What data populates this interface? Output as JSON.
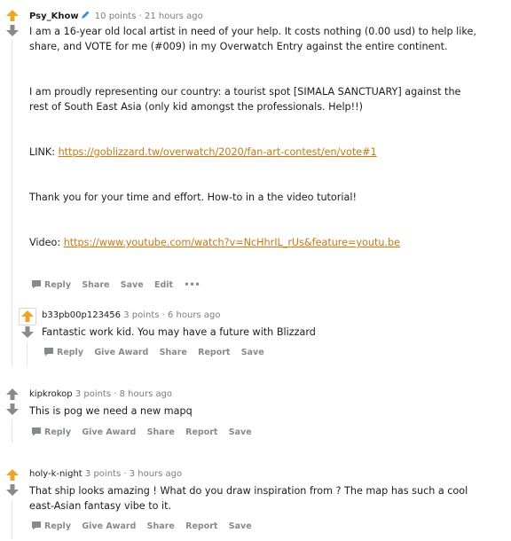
{
  "colors": {
    "upvote": "#f0a420",
    "downvote": "#8a8a8a",
    "link": "#c9780e"
  },
  "comments": [
    {
      "author": "Psy_Khow",
      "author_icon": "pen-icon",
      "points": "10 points",
      "time": "21 hours ago",
      "upvoted": true,
      "paragraphs": [
        "I am a 16-year old local artist in need of your help. It costs nothing (0.00 usd) to help like, share, and VOTE for me (#009) in my Overwatch Entry against the entire continent.",
        "I am proudly representing our country: a tourist spot [SIMALA SANCTUARY] against the rest of South East Asia (only kid amongst the professionals. Help!!)"
      ],
      "link_label": "LINK:",
      "link_url": "https://goblizzard.tw/overwatch/2020/fan-art-contest/en/vote#1",
      "thanks": "Thank you for your time and effort. How-to in a the video tutorial!",
      "video_label": "Video:",
      "video_url": "https://www.youtube.com/watch?v=NcHhrIL_rUs&feature=youtu.be",
      "actions": [
        "Reply",
        "Share",
        "Save",
        "Edit",
        "•••"
      ]
    },
    {
      "author": "b33pb00p123456",
      "points": "3 points",
      "time": "6 hours ago",
      "upvoted": true,
      "text": "Fantastic work kid. You may have a future with Blizzard",
      "actions": [
        "Reply",
        "Give Award",
        "Share",
        "Report",
        "Save"
      ]
    },
    {
      "author": "kipkrokop",
      "points": "3 points",
      "time": "8 hours ago",
      "upvoted": false,
      "text": "This is pog we need a new mapq",
      "actions": [
        "Reply",
        "Give Award",
        "Share",
        "Report",
        "Save"
      ]
    },
    {
      "author": "holy-k-night",
      "points": "3 points",
      "time": "3 hours ago",
      "upvoted": true,
      "text": "That ship looks amazing ! What do you draw inspiration from ? The map has such a cool east-Asian fantasy vibe to it.",
      "actions": [
        "Reply",
        "Give Award",
        "Share",
        "Report",
        "Save"
      ]
    }
  ]
}
